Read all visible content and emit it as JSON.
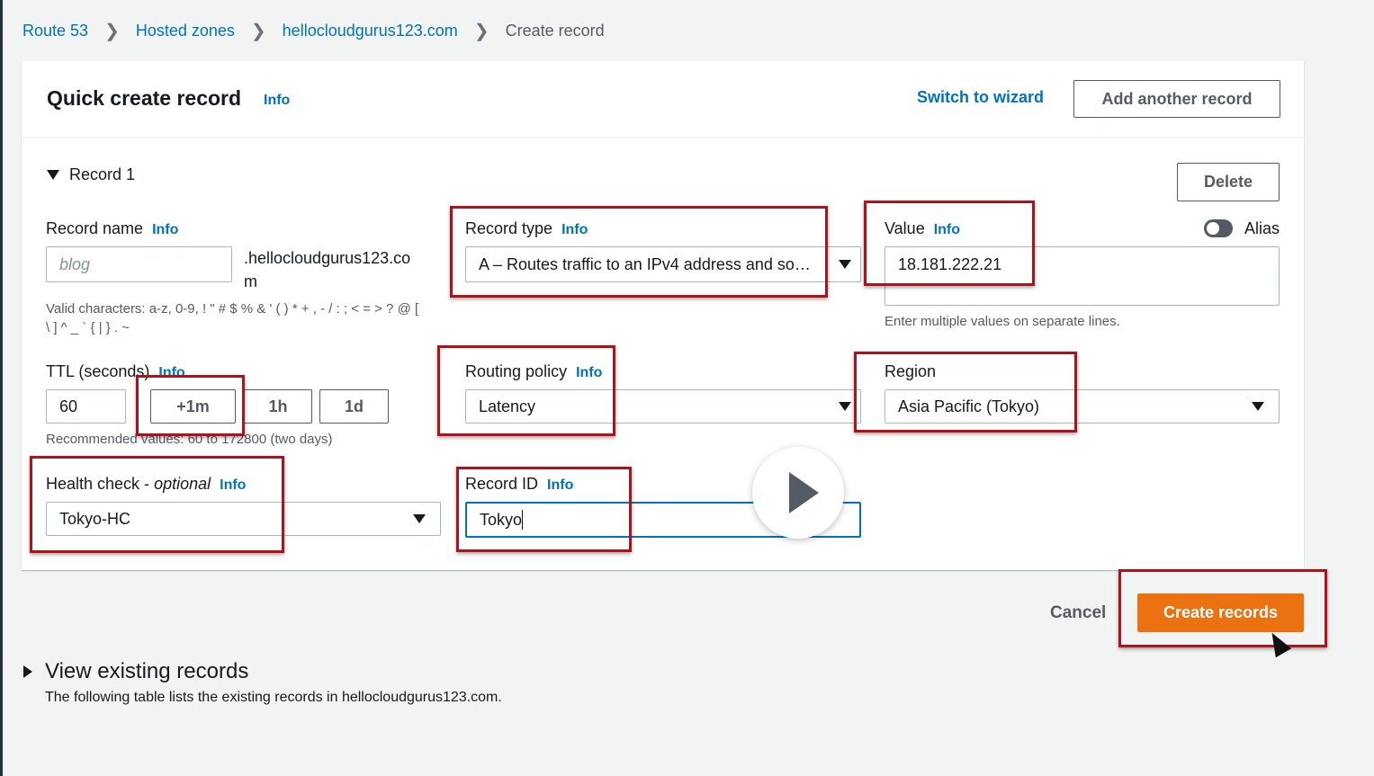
{
  "breadcrumbs": [
    "Route 53",
    "Hosted zones",
    "hellocloudgurus123.com",
    "Create record"
  ],
  "header": {
    "title": "Quick create record",
    "info": "Info",
    "switch_wizard": "Switch to wizard",
    "add_another": "Add another record"
  },
  "record": {
    "heading": "Record 1",
    "delete": "Delete",
    "name": {
      "label": "Record name",
      "info": "Info",
      "placeholder": "blog",
      "suffix": ".hellocloudgurus123.co\nm",
      "hint": "Valid characters: a-z, 0-9, ! \" # $ % & ' ( ) * + , - / : ; < = > ? @ [\n\\ ] ^ _ ` { | } . ~"
    },
    "type": {
      "label": "Record type",
      "info": "Info",
      "value": "A – Routes traffic to an IPv4 address and so…"
    },
    "value": {
      "label": "Value",
      "info": "Info",
      "text": "18.181.222.21",
      "hint": "Enter multiple values on separate lines."
    },
    "alias": {
      "label": "Alias",
      "enabled": false
    },
    "ttl": {
      "label": "TTL (seconds)",
      "info": "Info",
      "value": "60",
      "buttons": [
        "+1m",
        "1h",
        "1d"
      ],
      "hint": "Recommended values: 60 to 172800 (two days)"
    },
    "routing": {
      "label": "Routing policy",
      "info": "Info",
      "value": "Latency"
    },
    "region": {
      "label": "Region",
      "value": "Asia Pacific (Tokyo)"
    },
    "health": {
      "label": "Health check - ",
      "label_optional": "optional",
      "info": "Info",
      "value": "Tokyo-HC"
    },
    "record_id": {
      "label": "Record ID",
      "info": "Info",
      "value": "Tokyo"
    }
  },
  "footer": {
    "cancel": "Cancel",
    "create": "Create records"
  },
  "existing": {
    "title": "View existing records",
    "desc": "The following table lists the existing records in hellocloudgurus123.com."
  },
  "colors": {
    "link": "#0073bb",
    "primary": "#ec7211",
    "highlight": "#b0111a"
  }
}
